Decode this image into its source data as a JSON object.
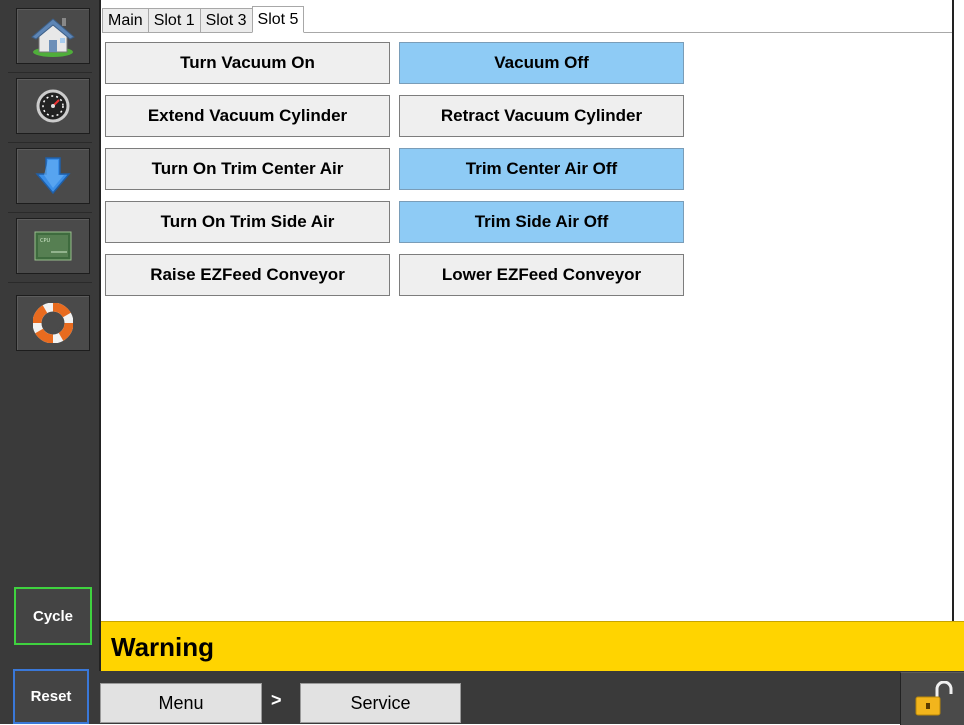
{
  "tabs": [
    {
      "label": "Main",
      "active": false
    },
    {
      "label": "Slot 1",
      "active": false
    },
    {
      "label": "Slot 3",
      "active": false
    },
    {
      "label": "Slot 5",
      "active": true
    }
  ],
  "sidebar": {
    "icons": [
      "home-icon",
      "gauge-icon",
      "download-arrow-icon",
      "cpu-icon",
      "life-ring-icon"
    ],
    "cycle_label": "Cycle",
    "cycle_color": "#3fd23f"
  },
  "controls": {
    "vacuum_on": "Turn Vacuum On",
    "vacuum_off": "Vacuum Off",
    "extend_cyl": "Extend Vacuum Cylinder",
    "retract_cyl": "Retract Vacuum Cylinder",
    "trim_center_on": "Turn On Trim Center Air",
    "trim_center_off": "Trim Center Air Off",
    "trim_side_on": "Turn On Trim Side Air",
    "trim_side_off": "Trim Side Air Off",
    "raise_conveyor": "Raise EZFeed Conveyor",
    "lower_conveyor": "Lower EZFeed Conveyor",
    "active_color": "#8ecbf5"
  },
  "status": {
    "warning": "Warning",
    "warning_color": "#ffd400"
  },
  "footer": {
    "reset_label": "Reset",
    "reset_color": "#3a78d8",
    "breadcrumb": [
      "Menu",
      "Service"
    ],
    "separator": ">",
    "lock_icon": "unlocked-padlock-icon"
  }
}
